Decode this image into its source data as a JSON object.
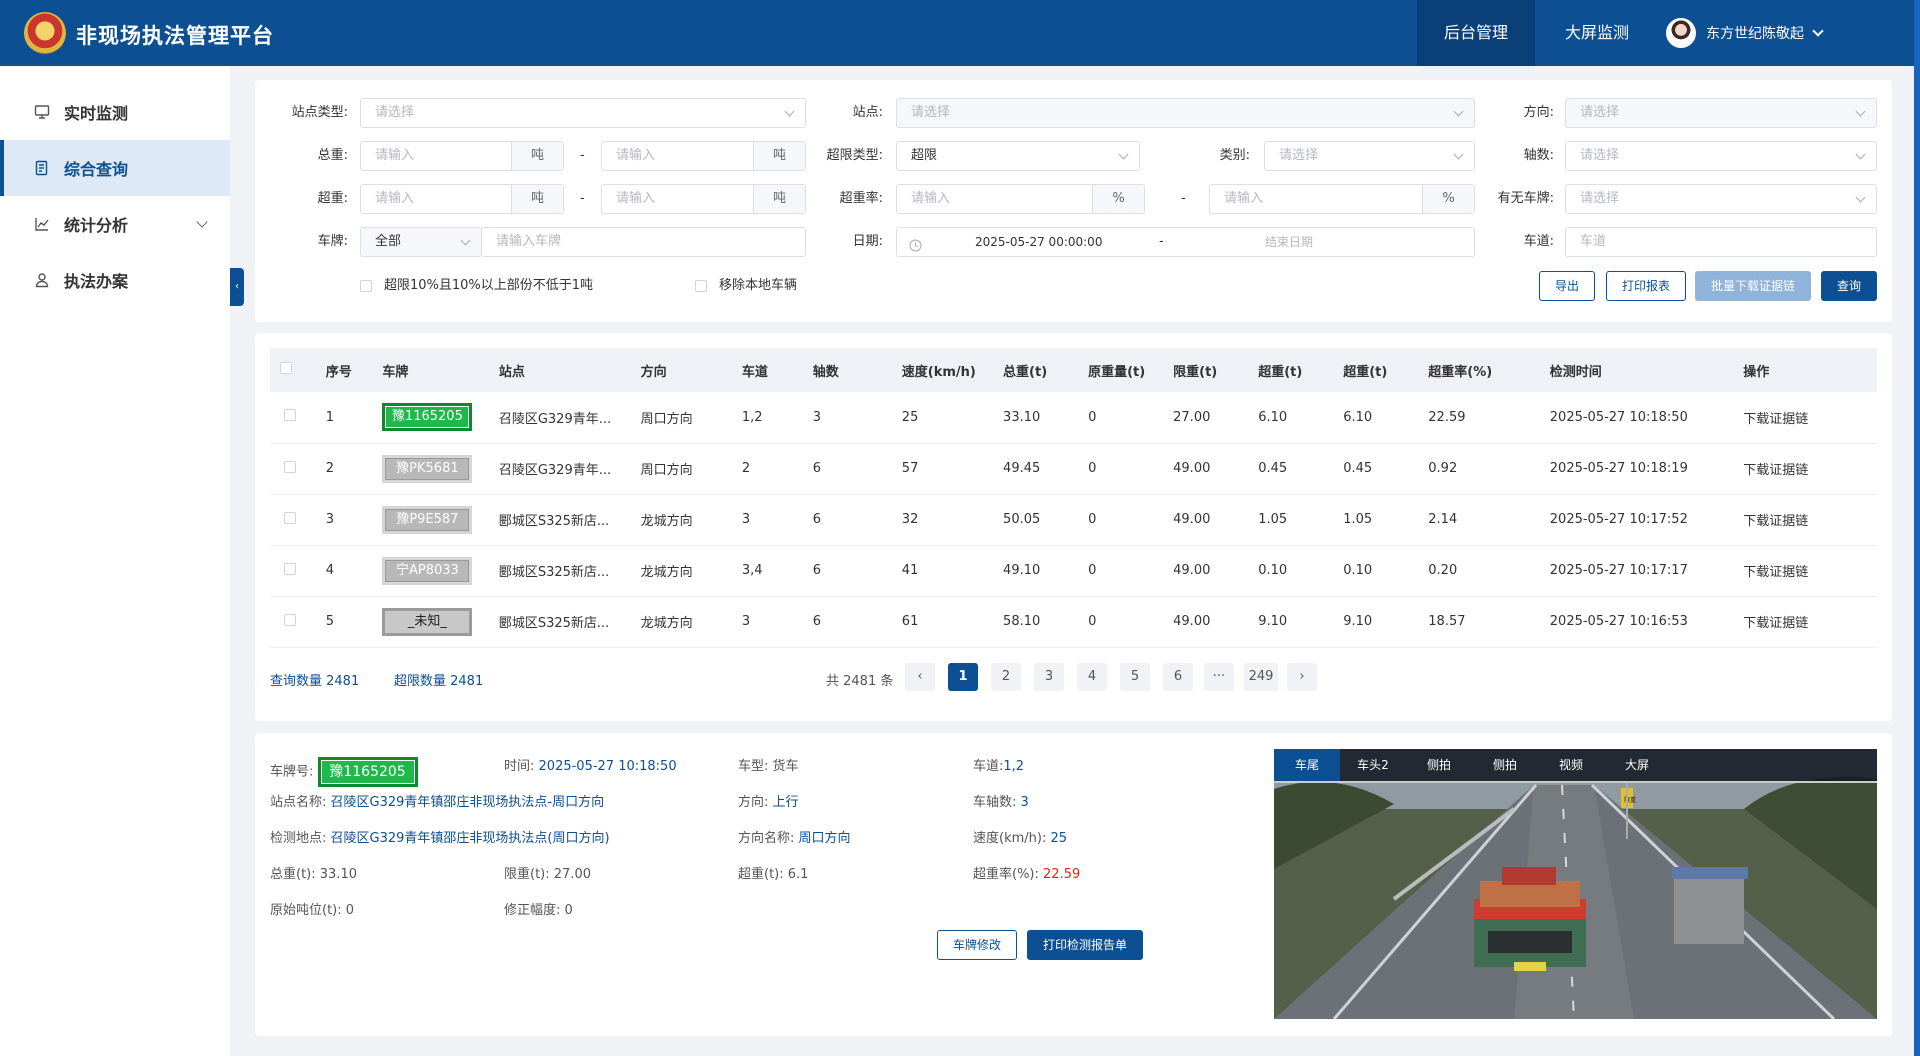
{
  "header": {
    "app_title": "非现场执法管理平台",
    "nav": [
      "后台管理",
      "大屏监测"
    ],
    "user": "东方世纪陈敬起"
  },
  "sidebar": {
    "items": [
      {
        "label": "实时监测",
        "icon": "monitor-icon"
      },
      {
        "label": "综合查询",
        "icon": "document-icon",
        "active": true
      },
      {
        "label": "统计分析",
        "icon": "chart-icon",
        "expandable": true
      },
      {
        "label": "执法办案",
        "icon": "user-case-icon"
      }
    ]
  },
  "filters": {
    "site_type": {
      "label": "站点类型:",
      "placeholder": "请选择"
    },
    "site": {
      "label": "站点:",
      "placeholder": "请选择"
    },
    "direction": {
      "label": "方向:",
      "placeholder": "请选择"
    },
    "total_weight": {
      "label": "总重:",
      "placeholder_from": "请输入",
      "placeholder_to": "请输入",
      "unit": "吨"
    },
    "overlimit_type": {
      "label": "超限类型:",
      "value": "超限"
    },
    "category": {
      "label": "类别:",
      "placeholder": "请选择"
    },
    "axle_count": {
      "label": "轴数:",
      "placeholder": "请选择"
    },
    "overweight": {
      "label": "超重:",
      "placeholder_from": "请输入",
      "placeholder_to": "请输入",
      "unit": "吨"
    },
    "overweight_rate": {
      "label": "超重率:",
      "placeholder_from": "请输入",
      "placeholder_to": "请输入",
      "unit": "%"
    },
    "has_plate": {
      "label": "有无车牌:",
      "placeholder": "请选择"
    },
    "plate": {
      "label": "车牌:",
      "select_value": "全部",
      "placeholder": "请输入车牌"
    },
    "date": {
      "label": "日期:",
      "start": "2025-05-27 00:00:00",
      "end_placeholder": "结束日期"
    },
    "lane": {
      "label": "车道:",
      "placeholder": "车道"
    },
    "dash": "-",
    "check1": "超限10%且10%以上部份不低于1吨",
    "check2": "移除本地车辆",
    "buttons": {
      "export": "导出",
      "print": "打印报表",
      "batch": "批量下载证据链",
      "query": "查询"
    }
  },
  "table": {
    "columns": [
      "序号",
      "车牌",
      "站点",
      "方向",
      "车道",
      "轴数",
      "速度(km/h)",
      "总重(t)",
      "原重量(t)",
      "限重(t)",
      "超重(t)",
      "超重(t)",
      "超重率(%)",
      "检测时间",
      "操作"
    ],
    "rows": [
      {
        "no": "1",
        "plate": "豫1165205",
        "plate_color": "green",
        "site": "召陵区G329青年...",
        "dir": "周口方向",
        "lane": "1,2",
        "axles": "3",
        "speed": "25",
        "total": "33.10",
        "orig": "0",
        "limit": "27.00",
        "over": "6.10",
        "over2": "6.10",
        "rate": "22.59",
        "time": "2025-05-27 10:18:50",
        "action": "下载证据链"
      },
      {
        "no": "2",
        "plate": "豫PK5681",
        "plate_color": "gray",
        "site": "召陵区G329青年...",
        "dir": "周口方向",
        "lane": "2",
        "axles": "6",
        "speed": "57",
        "total": "49.45",
        "orig": "0",
        "limit": "49.00",
        "over": "0.45",
        "over2": "0.45",
        "rate": "0.92",
        "time": "2025-05-27 10:18:19",
        "action": "下载证据链"
      },
      {
        "no": "3",
        "plate": "豫P9E587",
        "plate_color": "gray",
        "site": "郾城区S325新店...",
        "dir": "龙城方向",
        "lane": "3",
        "axles": "6",
        "speed": "32",
        "total": "50.05",
        "orig": "0",
        "limit": "49.00",
        "over": "1.05",
        "over2": "1.05",
        "rate": "2.14",
        "time": "2025-05-27 10:17:52",
        "action": "下载证据链"
      },
      {
        "no": "4",
        "plate": "宁AP8033",
        "plate_color": "gray",
        "site": "郾城区S325新店...",
        "dir": "龙城方向",
        "lane": "3,4",
        "axles": "6",
        "speed": "41",
        "total": "49.10",
        "orig": "0",
        "limit": "49.00",
        "over": "0.10",
        "over2": "0.10",
        "rate": "0.20",
        "time": "2025-05-27 10:17:17",
        "action": "下载证据链"
      },
      {
        "no": "5",
        "plate": "_未知_",
        "plate_color": "unknown",
        "site": "郾城区S325新店...",
        "dir": "龙城方向",
        "lane": "3",
        "axles": "6",
        "speed": "61",
        "total": "58.10",
        "orig": "0",
        "limit": "49.00",
        "over": "9.10",
        "over2": "9.10",
        "rate": "18.57",
        "time": "2025-05-27 10:16:53",
        "action": "下载证据链"
      }
    ]
  },
  "summary": {
    "query_count": "查询数量 2481",
    "overlimit_count": "超限数量 2481",
    "total": "共 2481 条"
  },
  "pagination": {
    "pages": [
      "1",
      "2",
      "3",
      "4",
      "5",
      "6"
    ],
    "ellipsis": "···",
    "last": "249",
    "current": "1"
  },
  "detail": {
    "plate_label": "车牌号:",
    "plate": "豫1165205",
    "time_label": "时间:",
    "time": "2025-05-27 10:18:50",
    "vtype_label": "车型:",
    "vtype": "货车",
    "lane_label": "车道:",
    "lane": "1,2",
    "site_label": "站点名称:",
    "site": "召陵区G329青年镇邵庄非现场执法点-周口方向",
    "dir_label": "方向:",
    "dir": "上行",
    "axle_label": "车轴数:",
    "axle": "3",
    "loc_label": "检测地点:",
    "loc": "召陵区G329青年镇邵庄非现场执法点(周口方向)",
    "dirname_label": "方向名称:",
    "dirname": "周口方向",
    "speed_label": "速度(km/h):",
    "speed": "25",
    "total_label": "总重(t):",
    "total": "33.10",
    "limit_label": "限重(t):",
    "limit": "27.00",
    "over_label": "超重(t):",
    "over": "6.1",
    "rate_label": "超重率(%):",
    "rate": "22.59",
    "orig_label": "原始吨位(t):",
    "orig": "0",
    "fix_label": "修正幅度:",
    "fix": "0",
    "btn_edit": "车牌修改",
    "btn_print": "打印检测报告单"
  },
  "photo": {
    "tabs": [
      "车尾",
      "车头2",
      "侧拍",
      "侧拍",
      "视频",
      "大屏"
    ],
    "active": "车尾",
    "sign_text": "限重"
  },
  "colors": {
    "primary": "#0d4f93",
    "accent_red": "#e0241b",
    "plate_green": "#1fb84a"
  }
}
